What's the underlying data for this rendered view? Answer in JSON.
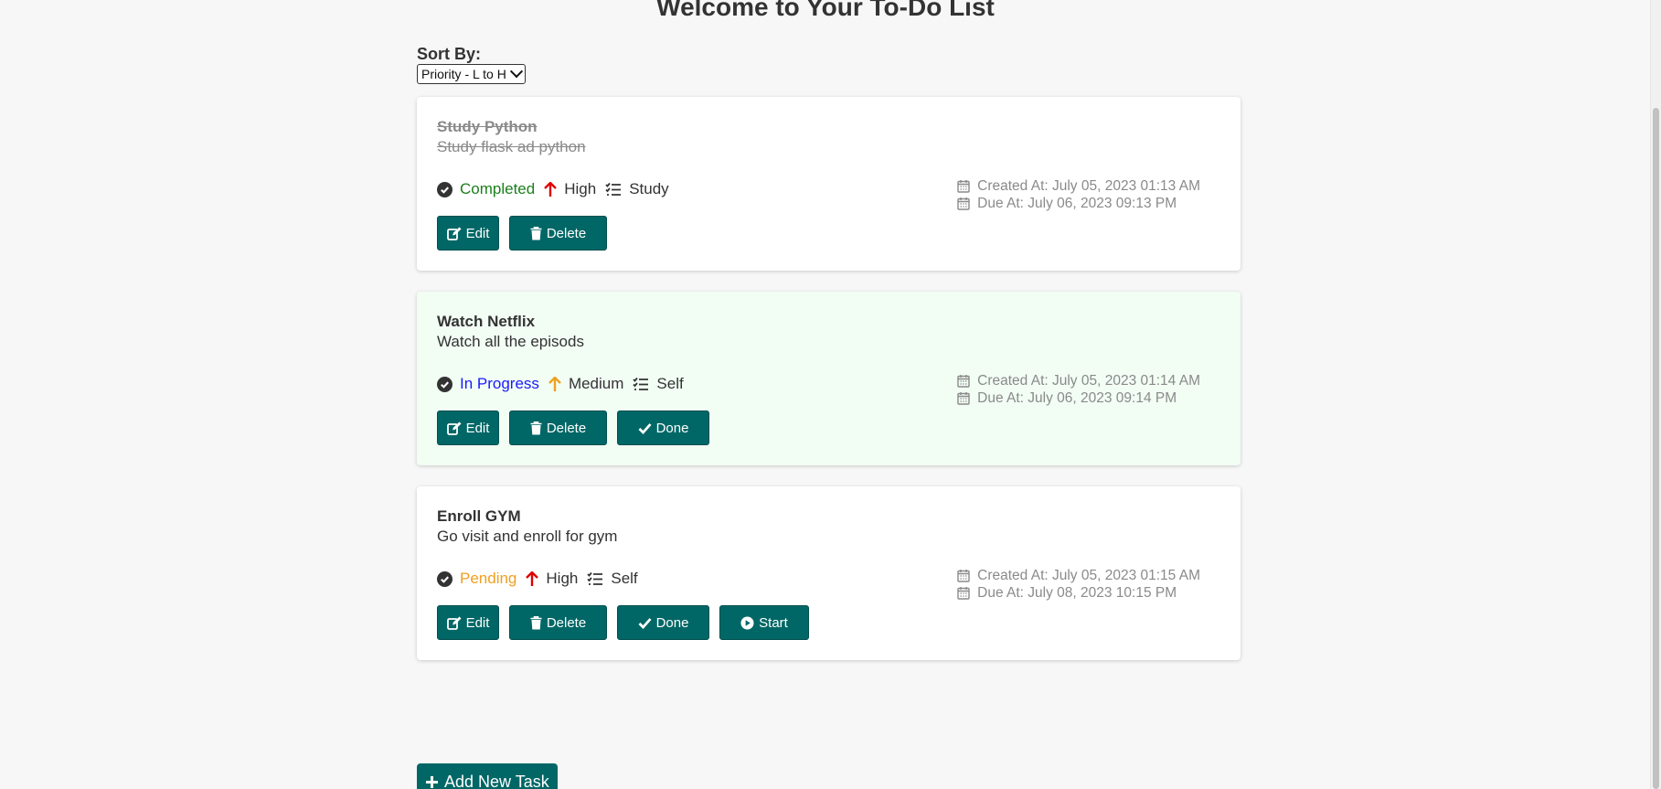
{
  "page": {
    "title": "Welcome to Your To-Do List"
  },
  "sort": {
    "label": "Sort By:",
    "selected": "Priority - L to H"
  },
  "tasks": [
    {
      "title": "Study Python",
      "description": "Study flask ad python",
      "status": "Completed",
      "priority": "High",
      "category": "Study",
      "created_at": "Created At: July 05, 2023 01:13 AM",
      "due_at": "Due At: July 06, 2023 09:13 PM",
      "edit_label": "Edit",
      "delete_label": "Delete"
    },
    {
      "title": "Watch Netflix",
      "description": "Watch all the episods",
      "status": "In Progress",
      "priority": "Medium",
      "category": "Self",
      "created_at": "Created At: July 05, 2023 01:14 AM",
      "due_at": "Due At: July 06, 2023 09:14 PM",
      "edit_label": "Edit",
      "delete_label": "Delete",
      "done_label": "Done"
    },
    {
      "title": "Enroll GYM",
      "description": "Go visit and enroll for gym",
      "status": "Pending",
      "priority": "High",
      "category": "Self",
      "created_at": "Created At: July 05, 2023 01:15 AM",
      "due_at": "Due At: July 08, 2023 10:15 PM",
      "edit_label": "Edit",
      "delete_label": "Delete",
      "done_label": "Done",
      "start_label": "Start"
    }
  ],
  "add_task": {
    "label": "Add New Task"
  },
  "colors": {
    "button": "#006766",
    "status_completed": "#1a7f1a",
    "status_in_progress": "#1a1aff",
    "status_pending": "#f0a020",
    "priority_high": "#e00000",
    "priority_medium": "#f0a020",
    "active_card_bg": "#f2fdf4"
  },
  "icons": {
    "status": "check-circle-icon",
    "priority_high": "arrow-up-icon",
    "priority_medium": "arrow-up-icon",
    "category": "list-check-icon",
    "date": "calendar-icon",
    "edit": "edit-icon",
    "delete": "trash-icon",
    "done": "check-icon",
    "start": "play-circle-icon",
    "add": "plus-icon"
  }
}
